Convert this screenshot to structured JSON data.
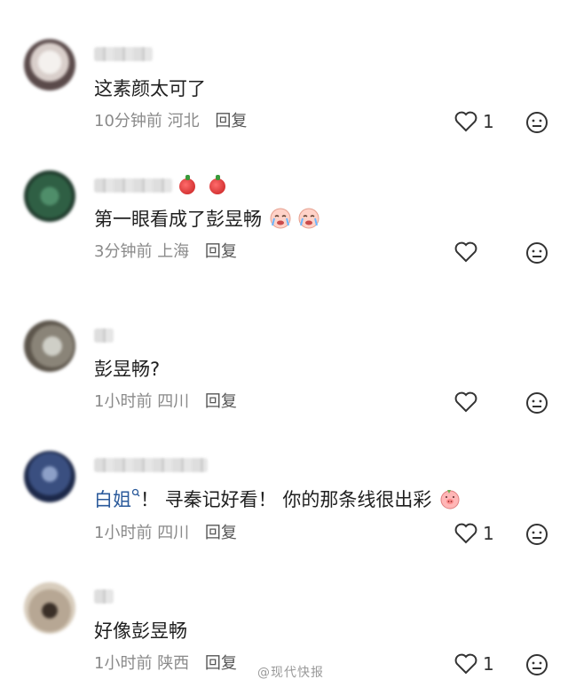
{
  "comments": [
    {
      "text": "这素颜太可了",
      "time": "10分钟前",
      "location": "河北",
      "reply_label": "回复",
      "likes": "1"
    },
    {
      "text": "第一眼看成了彭昱畅",
      "time": "3分钟前",
      "location": "上海",
      "reply_label": "回复",
      "likes": ""
    },
    {
      "text": "彭昱畅?",
      "time": "1小时前",
      "location": "四川",
      "reply_label": "回复",
      "likes": ""
    },
    {
      "mention": "白姐",
      "text": "！ 寻秦记好看！ 你的那条线很出彩",
      "time": "1小时前",
      "location": "四川",
      "reply_label": "回复",
      "likes": "1"
    },
    {
      "text": "好像彭昱畅",
      "time": "1小时前",
      "location": "陕西",
      "reply_label": "回复",
      "likes": "1"
    }
  ],
  "watermark": "@现代快报",
  "icons": {
    "like": "heart-outline-icon",
    "dislike": "neutral-face-icon",
    "mention_search": "search-small-icon",
    "emoji_crying": "crying-face-emoji",
    "emoji_pig": "pig-face-emoji",
    "badge": "apple-badge-icon"
  }
}
